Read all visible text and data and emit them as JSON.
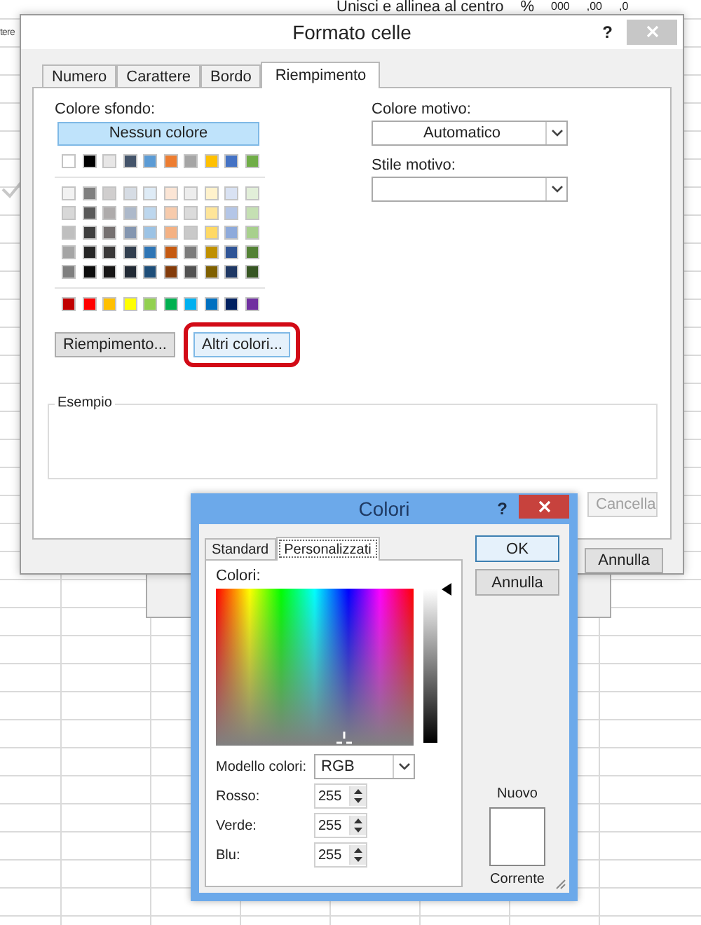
{
  "ribbon": {
    "left_label": "tere",
    "merge_button": "Unisci e allinea al centro",
    "percent": "%",
    "thousands": "000",
    "increase_decimals": ",00",
    "decrease_decimals": ",0"
  },
  "format_dialog": {
    "title": "Formato celle",
    "help": "?",
    "tabs": [
      {
        "label": "Numero",
        "selected": false
      },
      {
        "label": "Carattere",
        "selected": false
      },
      {
        "label": "Bordo",
        "selected": false
      },
      {
        "label": "Riempimento",
        "selected": true
      }
    ],
    "fill": {
      "background_label": "Colore sfondo:",
      "no_color_button": "Nessun colore",
      "theme_colors": [
        {
          "color": "#ffffff"
        },
        {
          "color": "#000000"
        },
        {
          "color": "#e7e6e6"
        },
        {
          "color": "#44546a"
        },
        {
          "color": "#5b9bd5"
        },
        {
          "color": "#ed7d31"
        },
        {
          "color": "#a5a5a5"
        },
        {
          "color": "#ffc000"
        },
        {
          "color": "#4472c4"
        },
        {
          "color": "#70ad47"
        }
      ],
      "tint_rows": [
        [
          {
            "color": "#f2f2f2"
          },
          {
            "color": "#7f7f7f"
          },
          {
            "color": "#d0cece"
          },
          {
            "color": "#d6dce4"
          },
          {
            "color": "#deebf6"
          },
          {
            "color": "#fbe5d5"
          },
          {
            "color": "#ededed"
          },
          {
            "color": "#fff2cc"
          },
          {
            "color": "#d9e2f3"
          },
          {
            "color": "#e2efd9"
          }
        ],
        [
          {
            "color": "#d8d8d8"
          },
          {
            "color": "#595959"
          },
          {
            "color": "#aeabab"
          },
          {
            "color": "#adb9ca"
          },
          {
            "color": "#bdd7ee"
          },
          {
            "color": "#f7cbac"
          },
          {
            "color": "#dbdbdb"
          },
          {
            "color": "#fee599"
          },
          {
            "color": "#b4c6e7"
          },
          {
            "color": "#c5e0b3"
          }
        ],
        [
          {
            "color": "#bfbfbf"
          },
          {
            "color": "#3f3f3f"
          },
          {
            "color": "#757070"
          },
          {
            "color": "#8496b0"
          },
          {
            "color": "#9cc3e5"
          },
          {
            "color": "#f4b183"
          },
          {
            "color": "#c9c9c9"
          },
          {
            "color": "#ffd965"
          },
          {
            "color": "#8eaadb"
          },
          {
            "color": "#a8d08d"
          }
        ],
        [
          {
            "color": "#a5a5a5"
          },
          {
            "color": "#262626"
          },
          {
            "color": "#3a3838"
          },
          {
            "color": "#323f4f"
          },
          {
            "color": "#2e75b5"
          },
          {
            "color": "#c55a11"
          },
          {
            "color": "#7b7b7b"
          },
          {
            "color": "#bf9000"
          },
          {
            "color": "#2f5496"
          },
          {
            "color": "#538135"
          }
        ],
        [
          {
            "color": "#7f7f7f"
          },
          {
            "color": "#0c0c0c"
          },
          {
            "color": "#171616"
          },
          {
            "color": "#222a35"
          },
          {
            "color": "#1e4e79"
          },
          {
            "color": "#843c0b"
          },
          {
            "color": "#525252"
          },
          {
            "color": "#7f6000"
          },
          {
            "color": "#1f3864"
          },
          {
            "color": "#375623"
          }
        ]
      ],
      "standard_colors": [
        {
          "color": "#c00000"
        },
        {
          "color": "#ff0000"
        },
        {
          "color": "#ffc000"
        },
        {
          "color": "#ffff00"
        },
        {
          "color": "#92d050"
        },
        {
          "color": "#00b050"
        },
        {
          "color": "#00b0f0"
        },
        {
          "color": "#0070c0"
        },
        {
          "color": "#002060"
        },
        {
          "color": "#7030a0"
        }
      ],
      "fill_effects_button": "Riempimento...",
      "more_colors_button": {
        "label": "Altri colori...",
        "highlighted": true
      },
      "pattern_color_label": "Colore motivo:",
      "pattern_color_value": "Automatico",
      "pattern_style_label": "Stile motivo:",
      "sample_label": "Esempio"
    },
    "buttons": [
      {
        "label": "Cancella",
        "disabled": true
      },
      {
        "label": "Annulla",
        "disabled": false
      }
    ]
  },
  "colors_dialog": {
    "title": "Colori",
    "help": "?",
    "tabs": [
      {
        "label": "Standard",
        "selected": false
      },
      {
        "label": "Personalizzati",
        "selected": true
      }
    ],
    "colors_label": "Colori:",
    "luminance_slider": {
      "level": 1
    },
    "model_label": "Modello colori:",
    "model_value": "RGB",
    "channels": [
      {
        "label": "Rosso:",
        "value": "255"
      },
      {
        "label": "Verde:",
        "value": "255"
      },
      {
        "label": "Blu:",
        "value": "255"
      }
    ],
    "ok_button": "OK",
    "cancel_button": "Annulla",
    "new_label": "Nuovo",
    "current_label": "Corrente"
  }
}
